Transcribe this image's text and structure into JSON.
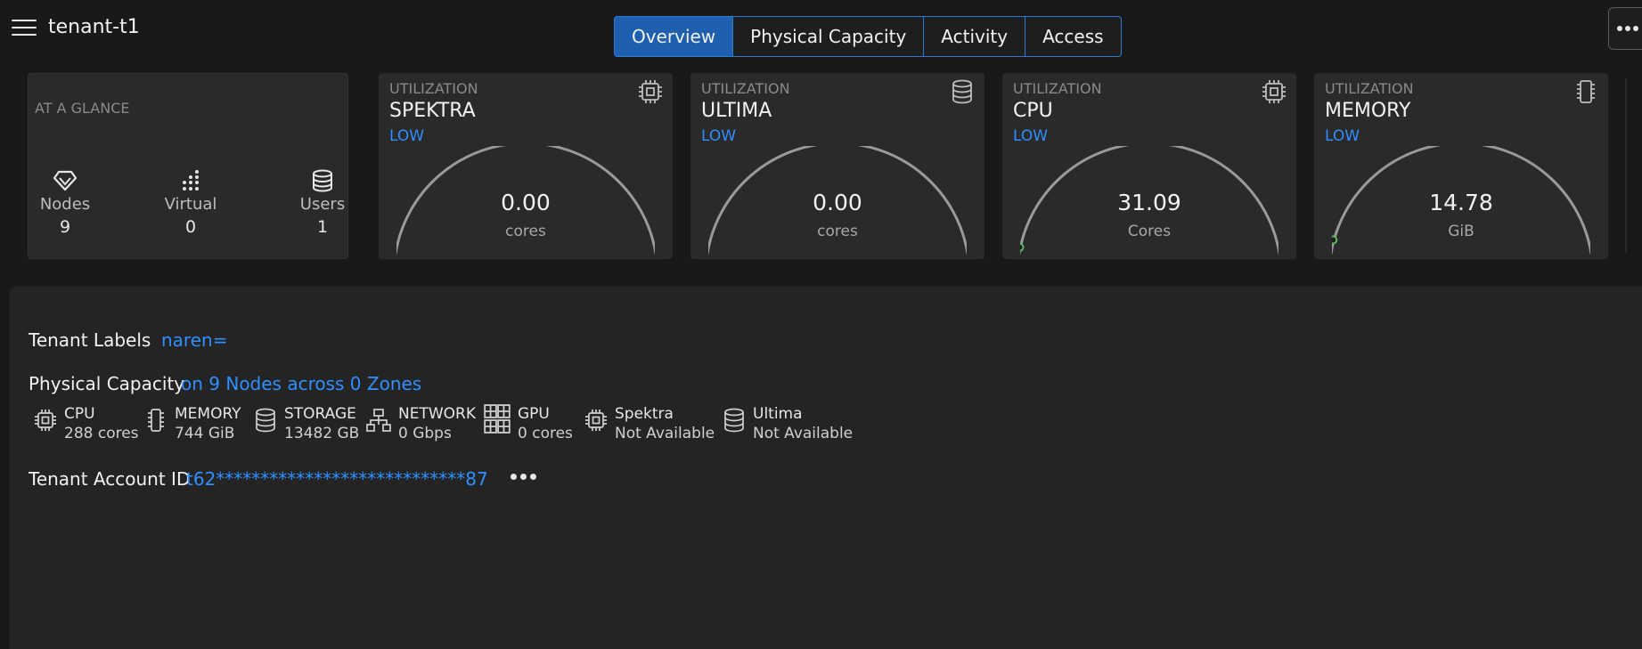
{
  "header": {
    "title": "tenant-t1",
    "tabs": [
      {
        "label": "Overview",
        "active": true
      },
      {
        "label": "Physical Capacity",
        "active": false
      },
      {
        "label": "Activity",
        "active": false
      },
      {
        "label": "Access",
        "active": false
      }
    ]
  },
  "glance": {
    "title": "AT A GLANCE",
    "stats": [
      {
        "label": "Nodes",
        "value": "9",
        "icon": "diamond-icon"
      },
      {
        "label": "Virtual",
        "value": "0",
        "icon": "virtual-nodes-icon"
      },
      {
        "label": "Users",
        "value": "1",
        "icon": "database-icon"
      }
    ]
  },
  "utilization": [
    {
      "heading": "UTILIZATION",
      "name": "SPEKTRA",
      "level": "LOW",
      "value": "0.00",
      "unit": "cores",
      "fraction": 0.0,
      "icon": "chip-icon"
    },
    {
      "heading": "UTILIZATION",
      "name": "ULTIMA",
      "level": "LOW",
      "value": "0.00",
      "unit": "cores",
      "fraction": 0.0,
      "icon": "database-icon"
    },
    {
      "heading": "UTILIZATION",
      "name": "CPU",
      "level": "LOW",
      "value": "31.09",
      "unit": "Cores",
      "fraction": 0.01,
      "icon": "chip-icon"
    },
    {
      "heading": "UTILIZATION",
      "name": "MEMORY",
      "level": "LOW",
      "value": "14.78",
      "unit": "GiB",
      "fraction": 0.03,
      "icon": "memory-icon"
    }
  ],
  "colors": {
    "accent": "#2e8fff",
    "tab_active": "#1e5fb0",
    "gauge_track": "#9a9a9a",
    "gauge_marker": "#5cb85c"
  },
  "labels": {
    "tenant_labels_label": "Tenant Labels",
    "tenant_labels_value": "naren=",
    "physical_capacity_label": "Physical Capacity",
    "physical_capacity_value": "on 9 Nodes across 0 Zones",
    "account_id_label": "Tenant Account ID",
    "account_id_value": "t62****************************87"
  },
  "capacity": [
    {
      "name": "CPU",
      "value": "288 cores",
      "icon": "chip-icon"
    },
    {
      "name": "MEMORY",
      "value": "744 GiB",
      "icon": "memory-icon"
    },
    {
      "name": "STORAGE",
      "value": "13482 GB",
      "icon": "database-icon"
    },
    {
      "name": "NETWORK",
      "value": "0 Gbps",
      "icon": "network-icon"
    },
    {
      "name": "GPU",
      "value": "0 cores",
      "icon": "gpu-grid-icon"
    },
    {
      "name": "Spektra",
      "value": "Not Available",
      "icon": "chip-icon"
    },
    {
      "name": "Ultima",
      "value": "Not Available",
      "icon": "database-icon"
    }
  ]
}
